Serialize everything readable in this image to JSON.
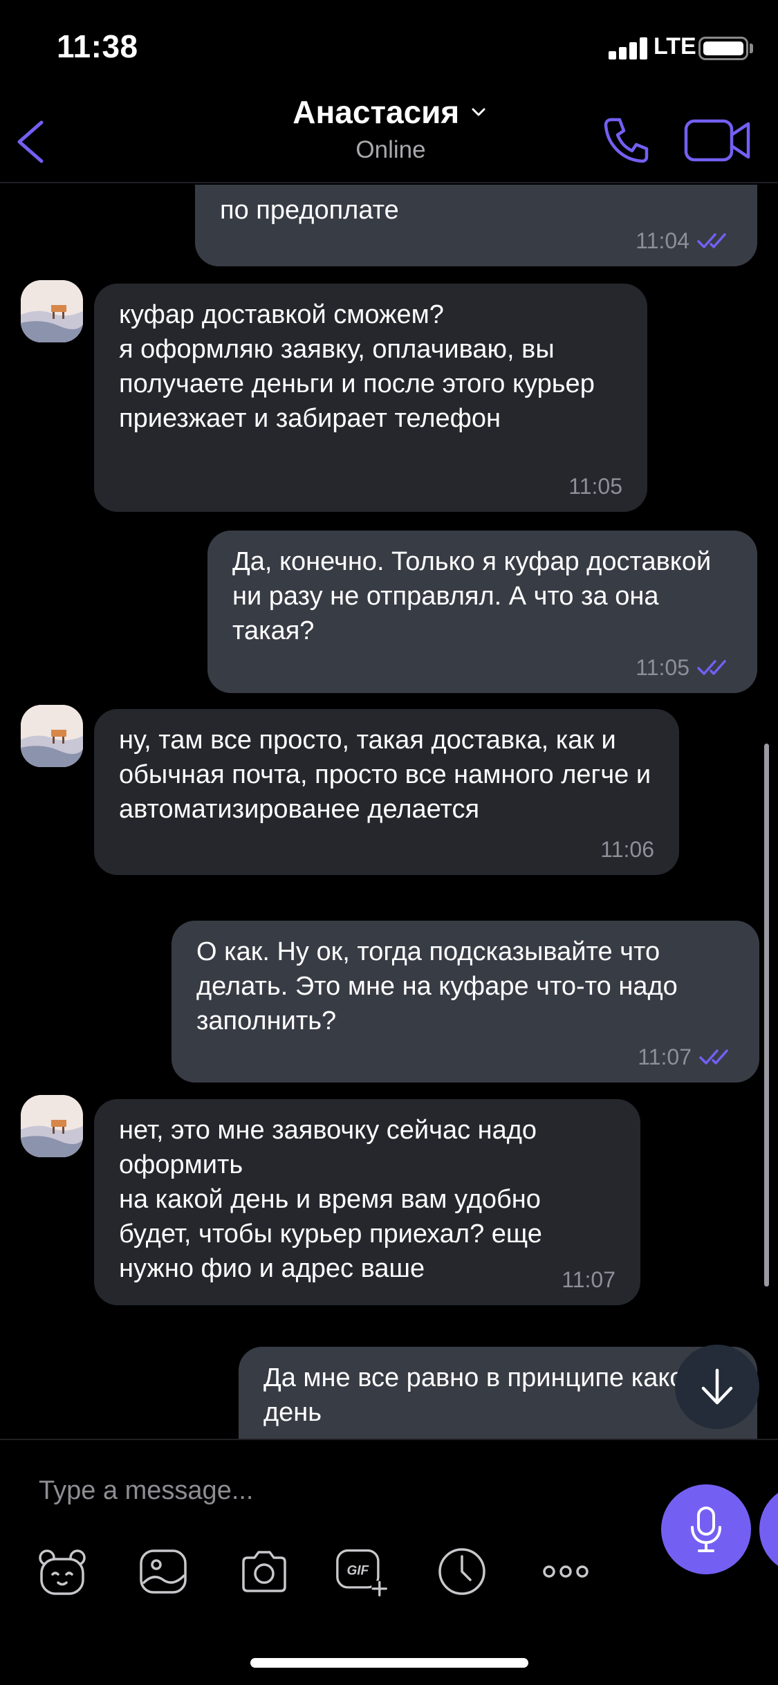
{
  "status_bar": {
    "time": "11:38",
    "network": "LTE"
  },
  "header": {
    "contact_name": "Анастасия",
    "contact_status": "Online"
  },
  "messages": [
    {
      "direction": "out",
      "text": "по предоплате",
      "time": "11:04",
      "read": true
    },
    {
      "direction": "in",
      "text": "куфар доставкой сможем?\nя оформляю заявку, оплачиваю, вы получаете деньги и после этого курьер приезжает и забирает телефон",
      "time": "11:05"
    },
    {
      "direction": "out",
      "text": "Да, конечно. Только я куфар доставкой ни разу не отправлял. А что за она такая?",
      "time": "11:05",
      "read": true
    },
    {
      "direction": "in",
      "text": "ну, там все просто, такая доставка, как и обычная почта, просто все намного легче и  автоматизированее делается",
      "time": "11:06"
    },
    {
      "direction": "out",
      "text": "О как. Ну ок, тогда подсказывайте что делать. Это мне на куфаре что-то надо заполнить?",
      "time": "11:07",
      "read": true
    },
    {
      "direction": "in",
      "text": "нет, это мне заявочку сейчас надо оформить\nна какой день и время вам удобно будет, чтобы курьер приехал? еще нужно фио и адрес ваше",
      "time": "11:07"
    },
    {
      "direction": "out",
      "text": "Да мне все равно в принципе какой день"
    }
  ],
  "composer": {
    "placeholder": "Type a message..."
  },
  "toolbar": {
    "icons": [
      "sticker-icon",
      "gallery-icon",
      "camera-icon",
      "gif-icon",
      "timer-icon",
      "more-icon"
    ]
  },
  "colors": {
    "accent": "#7360f2",
    "bubble_out": "#383c45",
    "bubble_in": "#25272d",
    "background": "#000000"
  }
}
